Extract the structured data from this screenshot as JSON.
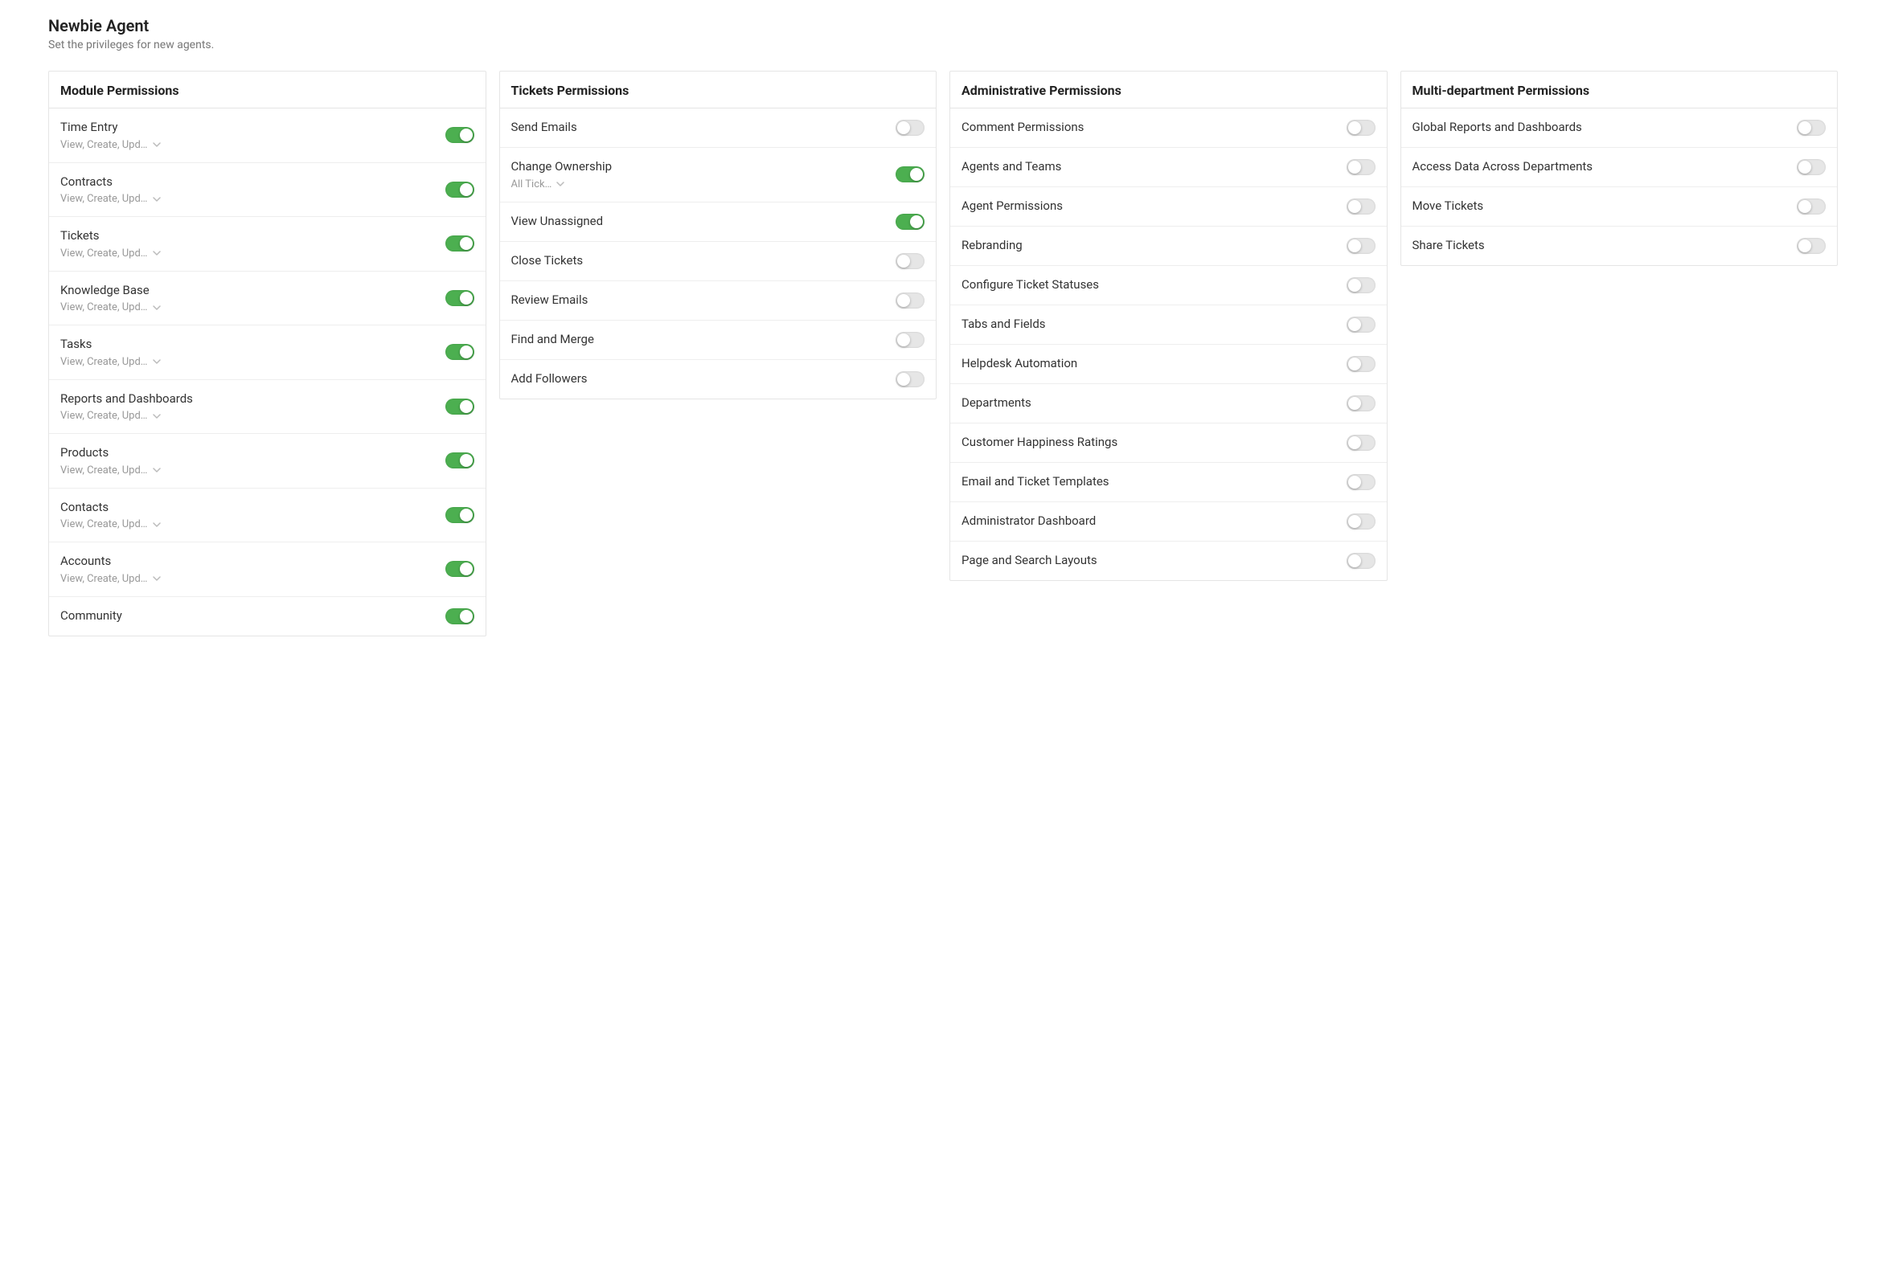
{
  "header": {
    "title": "Newbie Agent",
    "subtitle": "Set the privileges for new agents."
  },
  "panels": [
    {
      "title": "Module Permissions",
      "items": [
        {
          "label": "Time Entry",
          "sub": "View, Create, Upd…",
          "hasSub": true,
          "enabled": true
        },
        {
          "label": "Contracts",
          "sub": "View, Create, Upd…",
          "hasSub": true,
          "enabled": true
        },
        {
          "label": "Tickets",
          "sub": "View, Create, Upd…",
          "hasSub": true,
          "enabled": true
        },
        {
          "label": "Knowledge Base",
          "sub": "View, Create, Upd…",
          "hasSub": true,
          "enabled": true
        },
        {
          "label": "Tasks",
          "sub": "View, Create, Upd…",
          "hasSub": true,
          "enabled": true
        },
        {
          "label": "Reports and Dashboards",
          "sub": "View, Create, Upd…",
          "hasSub": true,
          "enabled": true
        },
        {
          "label": "Products",
          "sub": "View, Create, Upd…",
          "hasSub": true,
          "enabled": true
        },
        {
          "label": "Contacts",
          "sub": "View, Create, Upd…",
          "hasSub": true,
          "enabled": true
        },
        {
          "label": "Accounts",
          "sub": "View, Create, Upd…",
          "hasSub": true,
          "enabled": true
        },
        {
          "label": "Community",
          "sub": "",
          "hasSub": false,
          "enabled": true
        }
      ]
    },
    {
      "title": "Tickets Permissions",
      "items": [
        {
          "label": "Send Emails",
          "sub": "",
          "hasSub": false,
          "enabled": false
        },
        {
          "label": "Change Ownership",
          "sub": "All Tick…",
          "hasSub": true,
          "enabled": true
        },
        {
          "label": "View Unassigned",
          "sub": "",
          "hasSub": false,
          "enabled": true
        },
        {
          "label": "Close Tickets",
          "sub": "",
          "hasSub": false,
          "enabled": false
        },
        {
          "label": "Review Emails",
          "sub": "",
          "hasSub": false,
          "enabled": false
        },
        {
          "label": "Find and Merge",
          "sub": "",
          "hasSub": false,
          "enabled": false
        },
        {
          "label": "Add Followers",
          "sub": "",
          "hasSub": false,
          "enabled": false
        }
      ]
    },
    {
      "title": "Administrative Permissions",
      "items": [
        {
          "label": "Comment Permissions",
          "sub": "",
          "hasSub": false,
          "enabled": false
        },
        {
          "label": "Agents and Teams",
          "sub": "",
          "hasSub": false,
          "enabled": false
        },
        {
          "label": "Agent Permissions",
          "sub": "",
          "hasSub": false,
          "enabled": false
        },
        {
          "label": "Rebranding",
          "sub": "",
          "hasSub": false,
          "enabled": false
        },
        {
          "label": "Configure Ticket Statuses",
          "sub": "",
          "hasSub": false,
          "enabled": false
        },
        {
          "label": "Tabs and Fields",
          "sub": "",
          "hasSub": false,
          "enabled": false
        },
        {
          "label": "Helpdesk Automation",
          "sub": "",
          "hasSub": false,
          "enabled": false
        },
        {
          "label": "Departments",
          "sub": "",
          "hasSub": false,
          "enabled": false
        },
        {
          "label": "Customer Happiness Ratings",
          "sub": "",
          "hasSub": false,
          "enabled": false
        },
        {
          "label": "Email and Ticket Templates",
          "sub": "",
          "hasSub": false,
          "enabled": false
        },
        {
          "label": "Administrator Dashboard",
          "sub": "",
          "hasSub": false,
          "enabled": false
        },
        {
          "label": "Page and Search Layouts",
          "sub": "",
          "hasSub": false,
          "enabled": false
        }
      ]
    },
    {
      "title": "Multi-department Permissions",
      "items": [
        {
          "label": "Global Reports and Dashboards",
          "sub": "",
          "hasSub": false,
          "enabled": false
        },
        {
          "label": "Access Data Across Departments",
          "sub": "",
          "hasSub": false,
          "enabled": false
        },
        {
          "label": "Move Tickets",
          "sub": "",
          "hasSub": false,
          "enabled": false
        },
        {
          "label": "Share Tickets",
          "sub": "",
          "hasSub": false,
          "enabled": false
        }
      ]
    }
  ]
}
